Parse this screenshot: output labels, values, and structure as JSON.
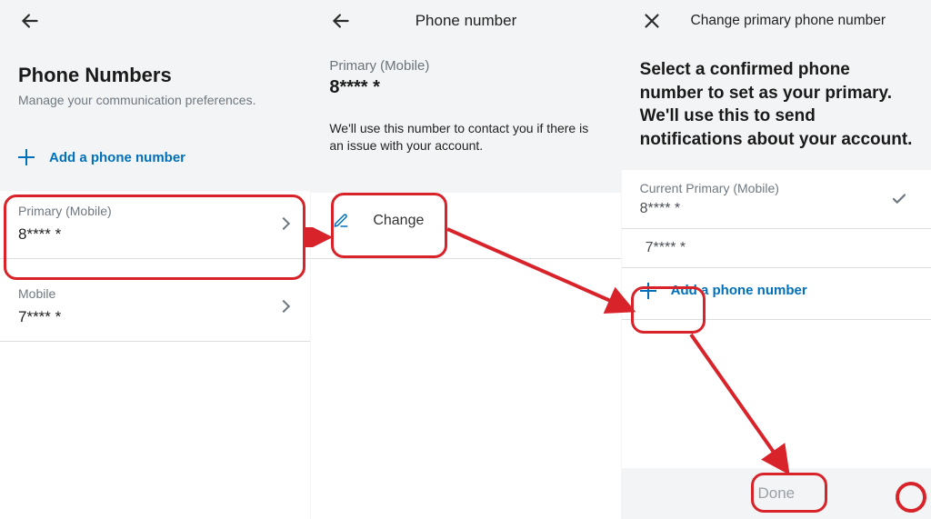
{
  "panel1": {
    "title": "Phone Numbers",
    "subtitle": "Manage your communication preferences.",
    "add_label": "Add a phone number",
    "rows": [
      {
        "label": "Primary (Mobile)",
        "value": "8**** *"
      },
      {
        "label": "Mobile",
        "value": "7**** *"
      }
    ]
  },
  "panel2": {
    "title": "Phone number",
    "primary_label": "Primary (Mobile)",
    "primary_value": "8**** *",
    "note": "We'll use this number to contact you if there is an issue with your account.",
    "change_label": "Change"
  },
  "panel3": {
    "title": "Change primary phone number",
    "prompt": "Select a confirmed phone number to set as your primary. We'll use this to send notifications about your account.",
    "current_label": "Current Primary (Mobile)",
    "current_value": "8**** *",
    "option_value": "7**** *",
    "add_label": "Add a phone number",
    "done_label": "Done"
  }
}
